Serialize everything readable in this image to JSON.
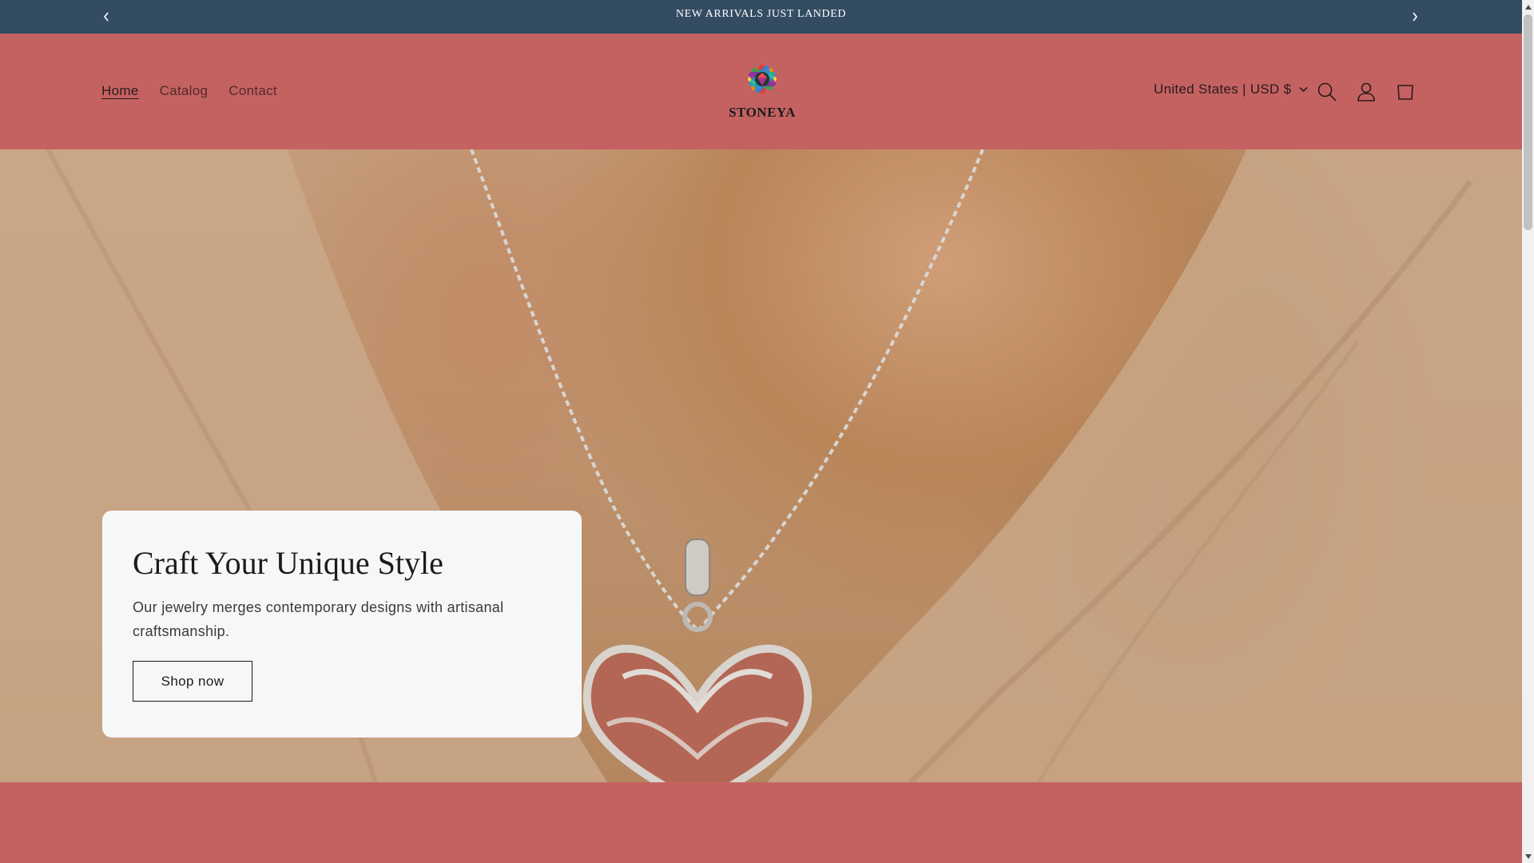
{
  "announcement": {
    "text": "NEW ARRIVALS JUST LANDED",
    "prev_icon": "chevron-left-icon",
    "next_icon": "chevron-right-icon"
  },
  "nav": {
    "items": [
      {
        "label": "Home",
        "active": true
      },
      {
        "label": "Catalog"
      },
      {
        "label": "Contact"
      }
    ]
  },
  "logo": {
    "text": "STONEYA"
  },
  "locale": {
    "label": "United States | USD $",
    "icon": "chevron-down-icon"
  },
  "header_icons": {
    "search": "search-icon",
    "account": "account-icon",
    "cart": "cart-icon"
  },
  "hero": {
    "title": "Craft Your Unique Style",
    "subtitle": "Our jewelry merges contemporary designs with artisanal craftsmanship.",
    "button": "Shop now"
  },
  "colors": {
    "announcement_bg": "#334c62",
    "header_bg": "#c46262",
    "card_bg": "#f6f7f9"
  }
}
